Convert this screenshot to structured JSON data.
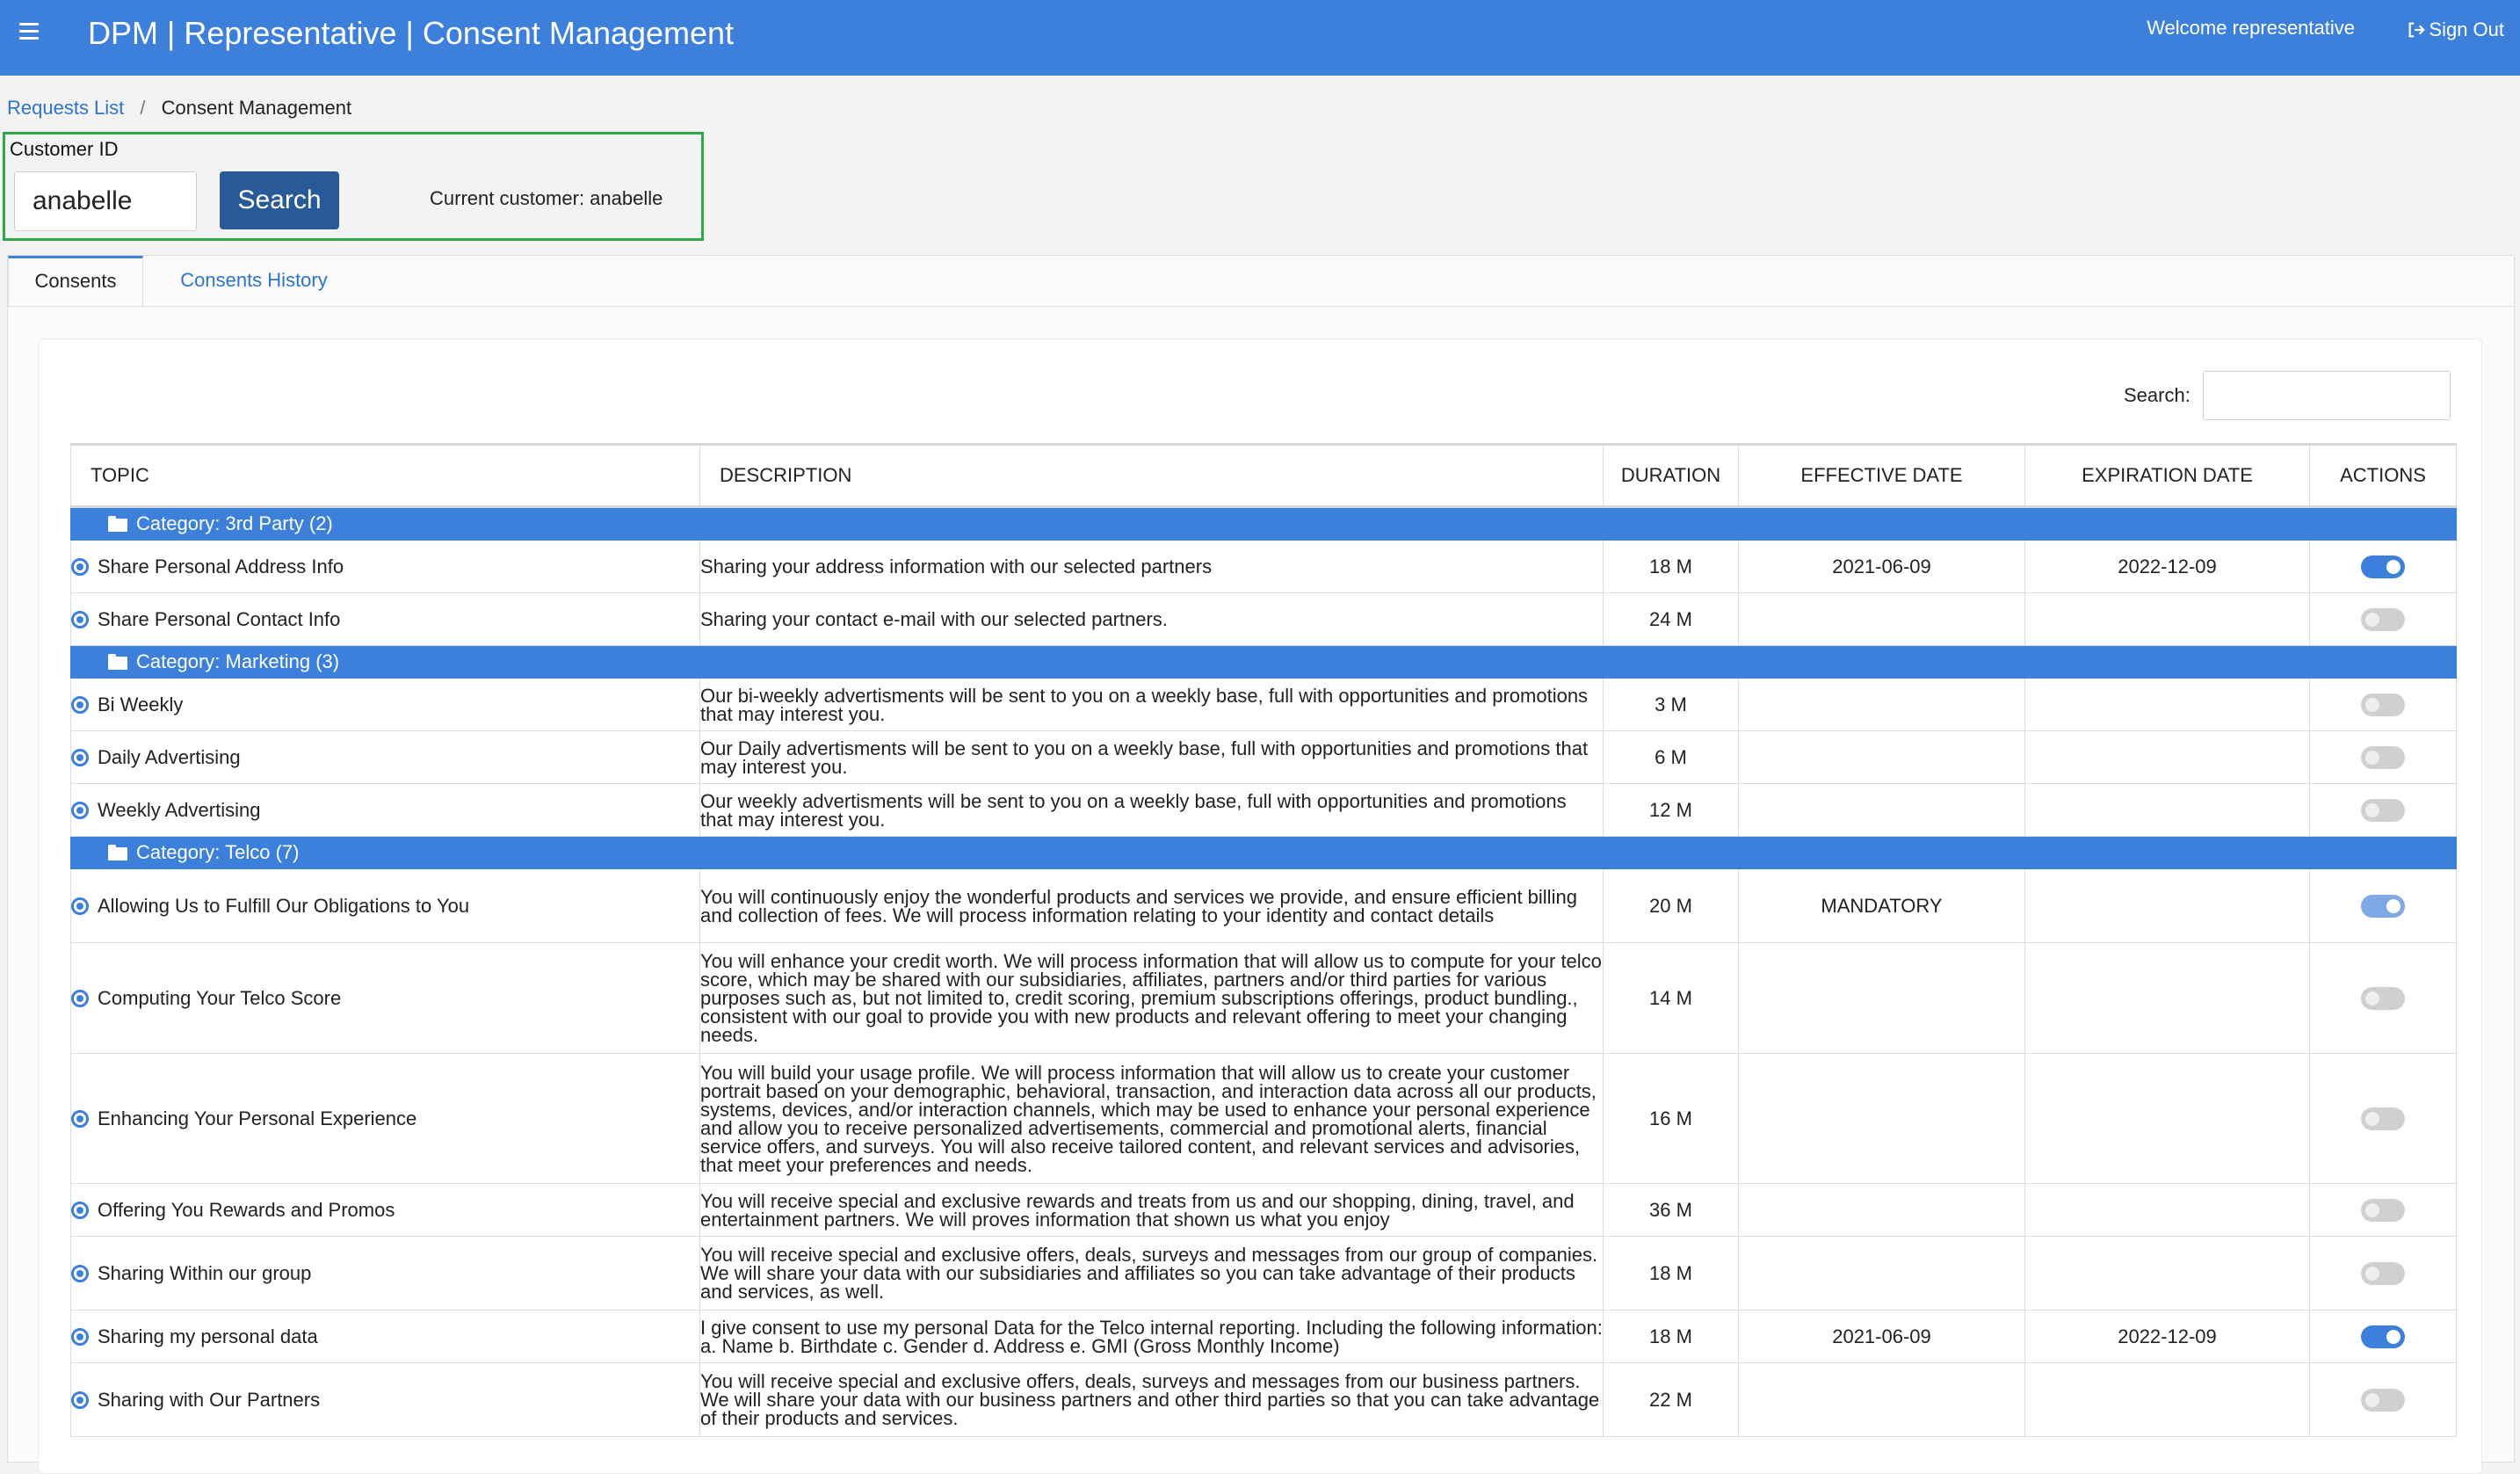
{
  "header": {
    "title": "DPM | Representative | Consent Management",
    "welcome": "Welcome representative",
    "signout": "Sign Out"
  },
  "breadcrumb": {
    "link": "Requests List",
    "separator": "/",
    "current": "Consent Management"
  },
  "customer": {
    "label": "Customer ID",
    "value": "anabelle",
    "search_button": "Search",
    "current": "Current customer: anabelle"
  },
  "tabs": [
    {
      "label": "Consents",
      "active": true
    },
    {
      "label": "Consents History",
      "active": false
    }
  ],
  "table_search": {
    "label": "Search:",
    "value": ""
  },
  "table": {
    "columns": [
      "TOPIC",
      "DESCRIPTION",
      "DURATION",
      "EFFECTIVE DATE",
      "EXPIRATION DATE",
      "ACTIONS"
    ],
    "categories": [
      {
        "label": "Category: 3rd Party (2)",
        "rows": [
          {
            "topic": "Share Personal Address Info",
            "description": "Sharing your address information with our selected partners",
            "duration": "18 M",
            "effective": "2021-06-09",
            "expiration": "2022-12-09",
            "enabled": true
          },
          {
            "topic": "Share Personal Contact Info",
            "description": "Sharing your contact e-mail with our selected partners.",
            "duration": "24 M",
            "effective": "",
            "expiration": "",
            "enabled": false
          }
        ]
      },
      {
        "label": "Category: Marketing (3)",
        "rows": [
          {
            "topic": "Bi Weekly",
            "description": "Our bi-weekly advertisments will be sent to you on a weekly base, full with opportunities and promotions that may interest you.",
            "duration": "3 M",
            "effective": "",
            "expiration": "",
            "enabled": false
          },
          {
            "topic": "Daily Advertising",
            "description": "Our Daily advertisments will be sent to you on a weekly base, full with opportunities and promotions that may interest you.",
            "duration": "6 M",
            "effective": "",
            "expiration": "",
            "enabled": false
          },
          {
            "topic": "Weekly Advertising",
            "description": "Our weekly advertisments will be sent to you on a weekly base, full with opportunities and promotions that may interest you.",
            "duration": "12 M",
            "effective": "",
            "expiration": "",
            "enabled": false
          }
        ]
      },
      {
        "label": "Category: Telco (7)",
        "rows": [
          {
            "topic": "Allowing Us to Fulfill Our Obligations to You",
            "description": "You will continuously enjoy the wonderful products and services we provide, and ensure efficient billing and collection of fees. We will process information relating to your identity and contact details",
            "duration": "20 M",
            "effective": "MANDATORY",
            "expiration": "",
            "enabled": true,
            "locked": true
          },
          {
            "topic": "Computing Your Telco Score",
            "description": "You will enhance your credit worth. We will process information that will allow us to compute for your telco score, which may be shared with our subsidiaries, affiliates, partners and/or third parties for various purposes such as, but not limited to, credit scoring, premium subscriptions offerings, product bundling., consistent with our goal to provide you with new products and relevant offering to meet your changing needs.",
            "duration": "14 M",
            "effective": "",
            "expiration": "",
            "enabled": false
          },
          {
            "topic": "Enhancing Your Personal Experience",
            "description": "You will build your usage profile. We will process information that will allow us to create your customer portrait based on your demographic, behavioral, transaction, and interaction data across all our products, systems, devices, and/or interaction channels, which may be used to enhance your personal experience and allow you to receive personalized advertisements, commercial and promotional alerts, financial service offers, and surveys. You will also receive tailored content, and relevant services and advisories, that meet your preferences and needs.",
            "duration": "16 M",
            "effective": "",
            "expiration": "",
            "enabled": false
          },
          {
            "topic": "Offering You Rewards and Promos",
            "description": "You will receive special and exclusive rewards and treats from us and our shopping, dining, travel, and entertainment partners. We will proves information that shown us what you enjoy",
            "duration": "36 M",
            "effective": "",
            "expiration": "",
            "enabled": false
          },
          {
            "topic": "Sharing Within our group",
            "description": "You will receive special and exclusive offers, deals, surveys and messages from our group of companies. We will share your data with our subsidiaries and affiliates so you can take advantage of their products and services, as well.",
            "duration": "18 M",
            "effective": "",
            "expiration": "",
            "enabled": false
          },
          {
            "topic": "Sharing my personal data",
            "description": "I give consent to use my personal Data for the Telco internal reporting. Including the following information: a. Name b. Birthdate c. Gender d. Address e. GMI (Gross Monthly Income)",
            "duration": "18 M",
            "effective": "2021-06-09",
            "expiration": "2022-12-09",
            "enabled": true
          },
          {
            "topic": "Sharing with Our Partners",
            "description": "You will receive special and exclusive offers, deals, surveys and messages from our business partners. We will share your data with our business partners and other third parties so that you can take advantage of their products and services.",
            "duration": "22 M",
            "effective": "",
            "expiration": "",
            "enabled": false
          }
        ]
      }
    ]
  },
  "colors": {
    "header_bg": "#3c80dc",
    "category_bg": "#3c80dc",
    "search_button_bg": "#285a9a",
    "highlight_border": "#2da94a",
    "link": "#2c74c9"
  }
}
